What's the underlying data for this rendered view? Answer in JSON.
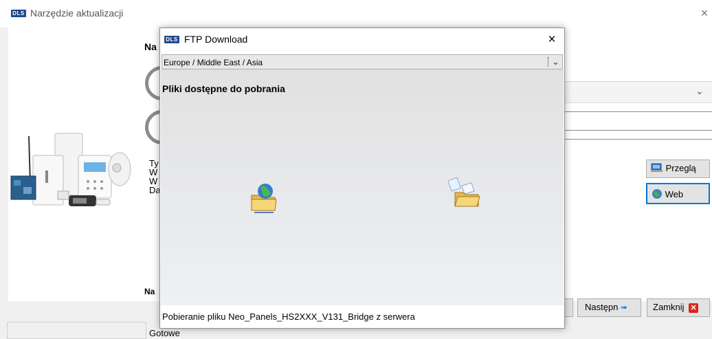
{
  "main_window": {
    "title": "Narzędzie aktualizacji",
    "logo_text": "DLS",
    "close_glyph": "×",
    "header_fragment": "Na",
    "info_lines": [
      "Ty",
      "W",
      "W",
      "Da"
    ],
    "bottom_fragment": "Na",
    "buttons": {
      "browse": "Przeglą",
      "web": "Web",
      "next": "Następn",
      "close": "Zamknij"
    },
    "status_text": "Gotowe"
  },
  "ftp_dialog": {
    "title": "FTP Download",
    "logo_text": "DLS",
    "close_glyph": "×",
    "region_selected": "Europe / Middle East / Asia",
    "heading": "Pliki dostępne do pobrania",
    "status": "Pobieranie pliku Neo_Panels_HS2XXX_V131_Bridge z serwera"
  },
  "icons": [
    "product-image",
    "globe-folder-icon",
    "folder-documents-icon",
    "browse-icon",
    "web-globe-icon",
    "arrow-right-icon",
    "close-x-icon"
  ],
  "colors": {
    "accent": "#0078d7",
    "close_red": "#d9281e",
    "logo_blue": "#1e4a8a"
  }
}
